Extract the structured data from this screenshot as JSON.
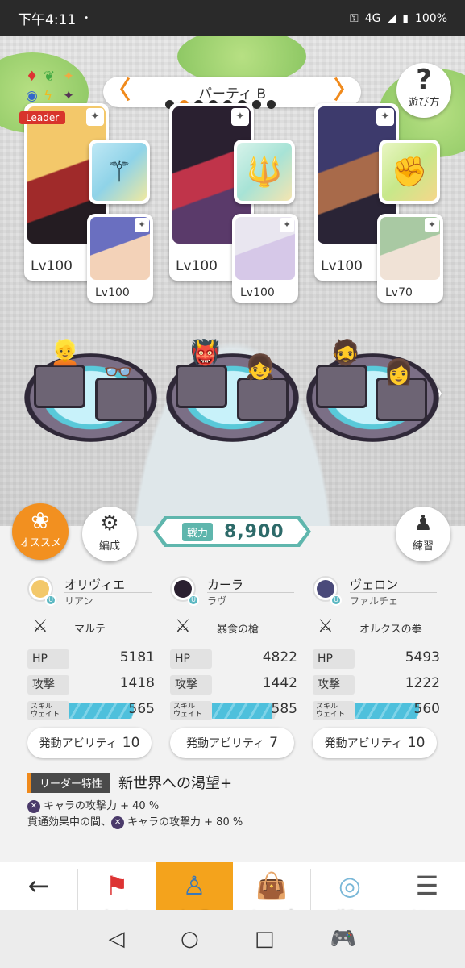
{
  "status_bar": {
    "time": "下午4:11",
    "dot": "•",
    "network": "4G",
    "battery": "100%"
  },
  "header": {
    "party_label": "パーティ B",
    "prev_arrow": "〈",
    "next_arrow": "〉",
    "help_icon": "?",
    "help_label": "遊び方",
    "dots_total": 8,
    "dots_active_index": 1
  },
  "team": [
    {
      "leader_tag": "Leader",
      "main_level": "Lv100",
      "sub_level": "Lv100",
      "weapon_icon": "staff-icon",
      "main_colors": [
        "#f3c86a",
        "#a02a2a"
      ],
      "sub_colors": [
        "#6a6fc0",
        "#f3d2b8"
      ],
      "weapon_bg": "#8fd3e8"
    },
    {
      "leader_tag": "",
      "main_level": "Lv100",
      "sub_level": "Lv100",
      "weapon_icon": "trident-icon",
      "main_colors": [
        "#2a2030",
        "#c0344a"
      ],
      "sub_colors": [
        "#e9e6f0",
        "#d6c8e8"
      ],
      "weapon_bg": "#a7e3d6"
    },
    {
      "leader_tag": "",
      "main_level": "Lv100",
      "sub_level": "Lv70",
      "weapon_icon": "fist-icon",
      "main_colors": [
        "#3d3a6c",
        "#a86a4a"
      ],
      "sub_colors": [
        "#a9c9a3",
        "#f0e2d6"
      ],
      "weapon_bg": "#c7e88a"
    }
  ],
  "actions": {
    "recommend_label": "オススメ",
    "formation_label": "編成",
    "training_label": "練習",
    "power_label": "戦力",
    "power_value": "8,900"
  },
  "members": [
    {
      "name": "オリヴィエ",
      "sub_name": "リアン",
      "weapon": "マルテ",
      "hp": "5181",
      "attack": "1418",
      "skill_wait": "565",
      "skill_fill": 0.95,
      "ability_label": "発動アビリティ",
      "ability_count": "10",
      "face_color": "#f3c86a"
    },
    {
      "name": "カーラ",
      "sub_name": "ラヴ",
      "weapon": "暴食の槍",
      "hp": "4822",
      "attack": "1442",
      "skill_wait": "585",
      "skill_fill": 0.88,
      "ability_label": "発動アビリティ",
      "ability_count": "7",
      "face_color": "#2a2030"
    },
    {
      "name": "ヴェロン",
      "sub_name": "ファルチェ",
      "weapon": "オルクスの拳",
      "hp": "5493",
      "attack": "1222",
      "skill_wait": "560",
      "skill_fill": 0.95,
      "ability_label": "発動アビリティ",
      "ability_count": "10",
      "face_color": "#4a4a7a"
    }
  ],
  "stat_labels": {
    "hp": "HP",
    "attack": "攻撃",
    "skill_line1": "スキル",
    "skill_line2": "ウェイト"
  },
  "leader_ability": {
    "tag": "リーダー特性",
    "title": "新世界への渇望+",
    "line1": "キャラの攻撃力 + 40 %",
    "line2_prefix": "貫通効果中の間、",
    "line2": "キャラの攻撃力 + 80 %"
  },
  "bottom_nav": [
    {
      "label": "もどる",
      "icon": "back-arrow-icon"
    },
    {
      "label": "ホーム",
      "icon": "home-icon"
    },
    {
      "label": "キャラ",
      "icon": "character-icon"
    },
    {
      "label": "ショップ",
      "icon": "shop-icon"
    },
    {
      "label": "ガチャ",
      "icon": "gacha-icon"
    },
    {
      "label": "メニュー",
      "icon": "menu-icon"
    }
  ],
  "colors": {
    "accent": "#f08a1c",
    "power_teal": "#5fb6ad",
    "skill_bar": "#4ec0dc",
    "active_nav": "#f4a31c"
  }
}
